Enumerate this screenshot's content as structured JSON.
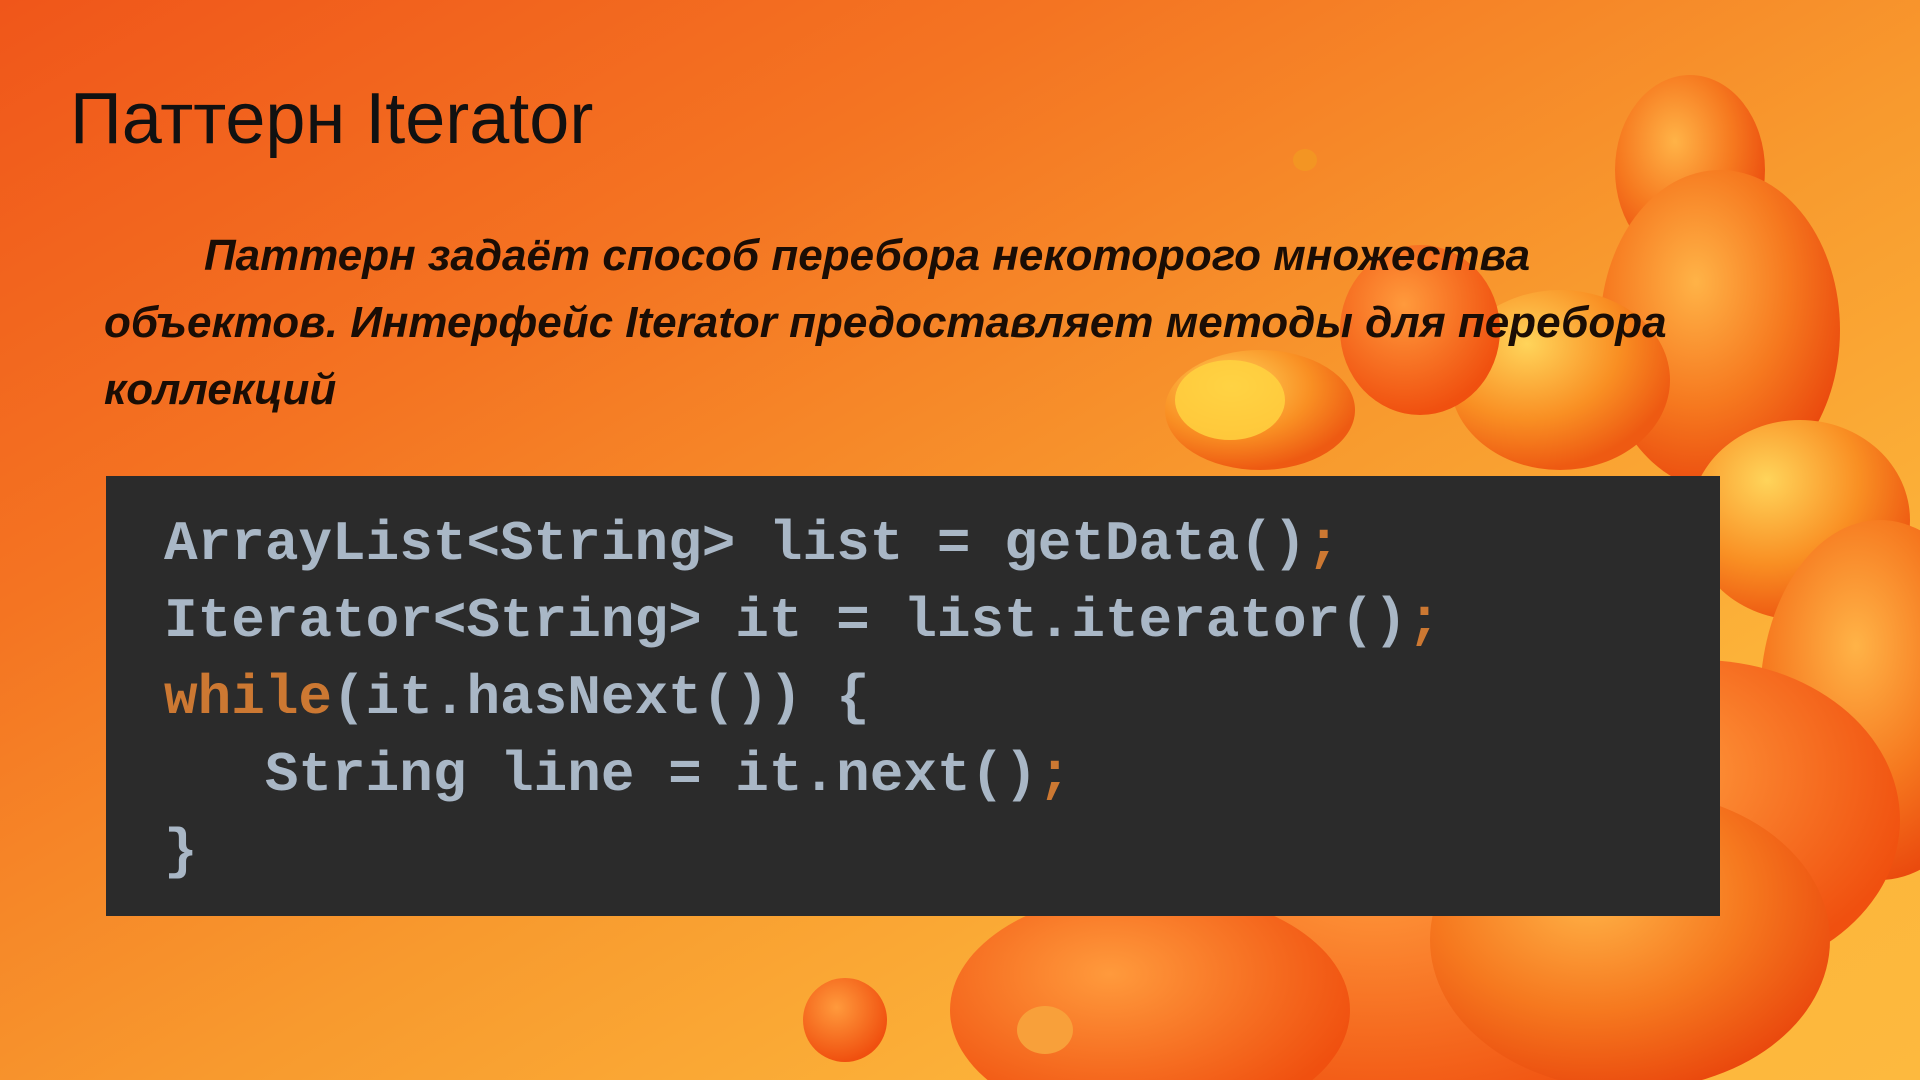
{
  "slide": {
    "title": "Паттерн Iterator",
    "description": "Паттерн задаёт способ перебора некоторого множества объектов. Интерфейс Iterator предоставляет методы для перебора коллекций"
  },
  "code": {
    "lines": [
      {
        "indent": "",
        "keyword": "",
        "text": "ArrayList<String> list = getData()",
        "semicolon": ";"
      },
      {
        "indent": "",
        "keyword": "",
        "text": "Iterator<String> it = list.iterator()",
        "semicolon": ";"
      },
      {
        "indent": "",
        "keyword": "while",
        "text": "(it.hasNext()) {",
        "semicolon": ""
      },
      {
        "indent": "   ",
        "keyword": "",
        "text": "String line = it.next()",
        "semicolon": ";"
      },
      {
        "indent": "",
        "keyword": "",
        "text": "}",
        "semicolon": ""
      }
    ]
  },
  "colors": {
    "code_background": "#2b2b2b",
    "code_text": "#a9b7c6",
    "keyword": "#cc7832",
    "background_accent": "#f47422"
  }
}
